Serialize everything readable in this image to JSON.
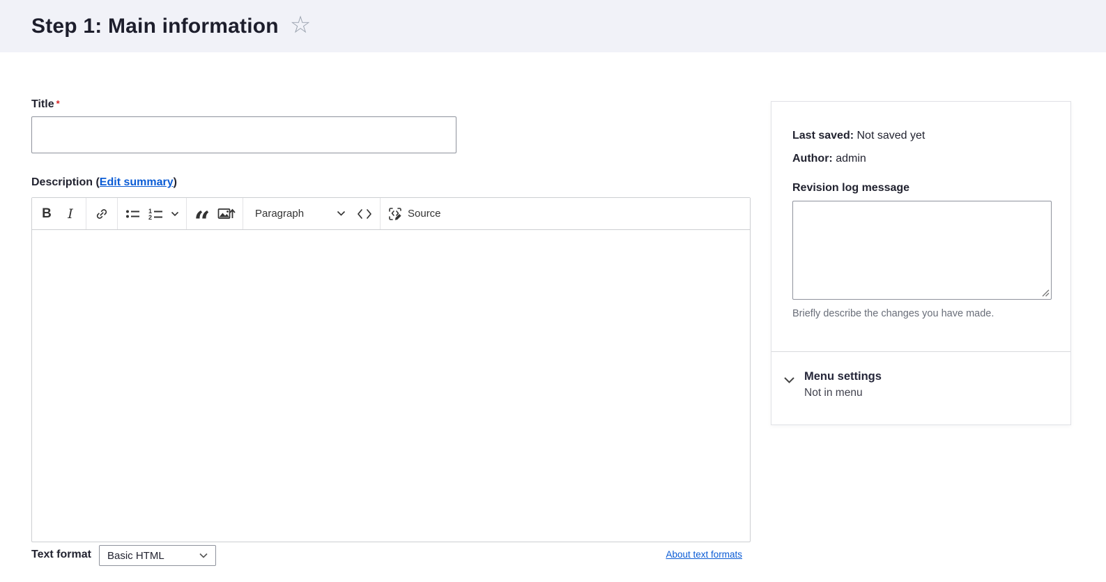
{
  "header": {
    "title": "Step 1: Main information"
  },
  "icons": {
    "star": "☆",
    "blockquote": "“"
  },
  "form": {
    "title": {
      "label": "Title",
      "required_mark": "*",
      "value": ""
    },
    "description": {
      "label": "Description",
      "paren_open": " (",
      "edit_summary_link": "Edit summary",
      "paren_close": ")"
    },
    "editor": {
      "toolbar": {
        "bold": "B",
        "italic": "I",
        "paragraph": "Paragraph",
        "source": "Source"
      },
      "body_text": ""
    },
    "text_format": {
      "label": "Text format",
      "value": "Basic HTML"
    },
    "about_text_formats_link": "About text formats"
  },
  "sidebar": {
    "last_saved": {
      "label": "Last saved:",
      "value": "Not saved yet"
    },
    "author": {
      "label": "Author:",
      "value": "admin"
    },
    "revision_log": {
      "label": "Revision log message",
      "value": "",
      "help": "Briefly describe the changes you have made."
    },
    "menu_settings": {
      "title": "Menu settings",
      "summary": "Not in menu"
    }
  },
  "colors": {
    "header_bg": "#f1f2f8",
    "text": "#222330",
    "link": "#0b5cd5",
    "required": "#d72222",
    "muted_text": "#696e79",
    "input_border": "#8e929c",
    "editor_border": "#ccced1"
  }
}
